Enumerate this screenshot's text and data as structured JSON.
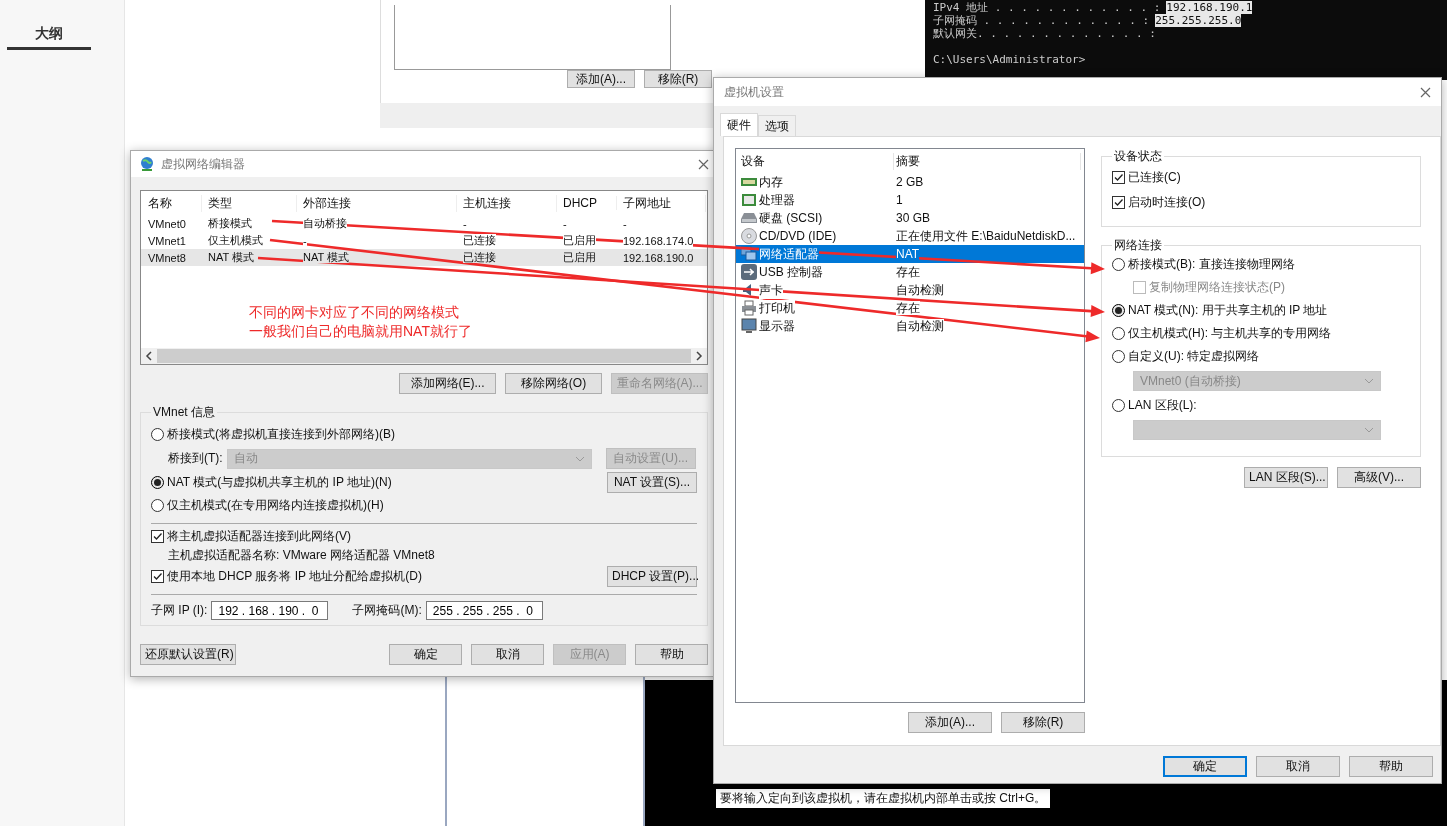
{
  "sidebar": {
    "tabs": [
      {
        "label": "大纲",
        "selected": true
      }
    ]
  },
  "back_window": {
    "buttons": [
      "添加(A)...",
      "移除(R)"
    ]
  },
  "terminal": {
    "lines": [
      {
        "label": "IPv4 地址 . . . . . . . . . . . . :",
        "value": "192.168.190.1"
      },
      {
        "label": "子网掩码 . . . . . . . . . . . . :",
        "value": "255.255.255.0"
      },
      {
        "label": "默认网关. . . . . . . . . . . . . :"
      }
    ],
    "prompt": "C:\\Users\\Administrator>",
    "status_text": "要将输入定向到该虚拟机，请在虚拟机内部单击或按 Ctrl+G。"
  },
  "network_editor": {
    "title": "虚拟网络编辑器",
    "table": {
      "columns": [
        "名称",
        "类型",
        "外部连接",
        "主机连接",
        "DHCP",
        "子网地址"
      ],
      "rows": [
        {
          "cells": [
            "VMnet0",
            "桥接模式",
            "自动桥接",
            "-",
            "-",
            "-"
          ],
          "selected": false
        },
        {
          "cells": [
            "VMnet1",
            "仅主机模式",
            "-",
            "已连接",
            "已启用",
            "192.168.174.0"
          ],
          "selected": false
        },
        {
          "cells": [
            "VMnet8",
            "NAT 模式",
            "NAT 模式",
            "已连接",
            "已启用",
            "192.168.190.0"
          ],
          "selected": true
        }
      ]
    },
    "annotation": [
      "不同的网卡对应了不同的网络模式",
      "一般我们自己的电脑就用NAT就行了"
    ],
    "table_buttons": [
      {
        "label": "添加网络(E)...",
        "disabled": false
      },
      {
        "label": "移除网络(O)",
        "disabled": false
      },
      {
        "label": "重命名网络(A)...",
        "disabled": true
      }
    ],
    "vmnet_info": {
      "title": "VMnet 信息",
      "modes": [
        {
          "label": "桥接模式(将虚拟机直接连接到外部网络)(B)",
          "selected": false
        },
        {
          "label": "NAT 模式(与虚拟机共享主机的 IP 地址)(N)",
          "selected": true
        },
        {
          "label": "仅主机模式(在专用网络内连接虚拟机)(H)",
          "selected": false
        }
      ],
      "bridge_label": "桥接到(T):",
      "bridge_value": "自动",
      "auto_button": {
        "label": "自动设置(U)...",
        "disabled": true
      },
      "nat_button": {
        "label": "NAT 设置(S)...",
        "disabled": false
      },
      "options": [
        {
          "label": "将主机虚拟适配器连接到此网络(V)",
          "checked": true
        },
        {
          "label": "使用本地 DHCP 服务将 IP 地址分配给虚拟机(D)",
          "checked": true
        }
      ],
      "adapter_name": "主机虚拟适配器名称: VMware 网络适配器 VMnet8",
      "dhcp_button": {
        "label": "DHCP 设置(P)...",
        "disabled": false
      },
      "subnet_ip_label": "子网 IP (I):",
      "subnet_ip": "192 . 168 . 190 .  0",
      "subnet_mask_label": "子网掩码(M):",
      "subnet_mask": "255 . 255 . 255 .  0"
    },
    "restore_button": "还原默认设置(R)",
    "buttons": [
      {
        "label": "确定",
        "disabled": false
      },
      {
        "label": "取消",
        "disabled": false
      },
      {
        "label": "应用(A)",
        "disabled": true
      },
      {
        "label": "帮助",
        "disabled": false
      }
    ]
  },
  "vm_settings": {
    "title": "虚拟机设置",
    "tabs": [
      {
        "label": "硬件",
        "selected": true
      },
      {
        "label": "选项",
        "selected": false
      }
    ],
    "devices": {
      "columns": [
        "设备",
        "摘要"
      ],
      "rows": [
        {
          "kind": "memory",
          "name": "内存",
          "summary": "2 GB",
          "selected": false
        },
        {
          "kind": "cpu",
          "name": "处理器",
          "summary": "1",
          "selected": false
        },
        {
          "kind": "disk",
          "name": "硬盘 (SCSI)",
          "summary": "30 GB",
          "selected": false
        },
        {
          "kind": "cd",
          "name": "CD/DVD (IDE)",
          "summary": "正在使用文件 E:\\BaiduNetdiskD...",
          "selected": false
        },
        {
          "kind": "network",
          "name": "网络适配器",
          "summary": "NAT",
          "selected": true
        },
        {
          "kind": "usb",
          "name": "USB 控制器",
          "summary": "存在",
          "selected": false
        },
        {
          "kind": "sound",
          "name": "声卡",
          "summary": "自动检测",
          "selected": false
        },
        {
          "kind": "printer",
          "name": "打印机",
          "summary": "存在",
          "selected": false
        },
        {
          "kind": "monitor",
          "name": "显示器",
          "summary": "自动检测",
          "selected": false
        }
      ]
    },
    "list_buttons": [
      "添加(A)...",
      "移除(R)"
    ],
    "device_status": {
      "title": "设备状态",
      "options": [
        {
          "label": "已连接(C)",
          "checked": true
        },
        {
          "label": "启动时连接(O)",
          "checked": true
        }
      ]
    },
    "network": {
      "title": "网络连接",
      "options": [
        {
          "kind": "radio",
          "label": "桥接模式(B): 直接连接物理网络",
          "selected": false
        },
        {
          "kind": "checkbox",
          "label": "复制物理网络连接状态(P)",
          "checked": false,
          "disabled": true
        },
        {
          "kind": "radio",
          "label": "NAT 模式(N): 用于共享主机的 IP 地址",
          "selected": true
        },
        {
          "kind": "radio",
          "label": "仅主机模式(H): 与主机共享的专用网络",
          "selected": false
        },
        {
          "kind": "radio",
          "label": "自定义(U): 特定虚拟网络",
          "selected": false
        },
        {
          "kind": "select",
          "value": "VMnet0 (自动桥接)",
          "disabled": true
        },
        {
          "kind": "radio",
          "label": "LAN 区段(L):",
          "selected": false
        },
        {
          "kind": "select",
          "disabled": true
        }
      ]
    },
    "extra_buttons": [
      "LAN 区段(S)...",
      "高级(V)..."
    ],
    "buttons": [
      {
        "label": "确定",
        "default": true
      },
      {
        "label": "取消",
        "default": false
      },
      {
        "label": "帮助",
        "default": false
      }
    ]
  }
}
